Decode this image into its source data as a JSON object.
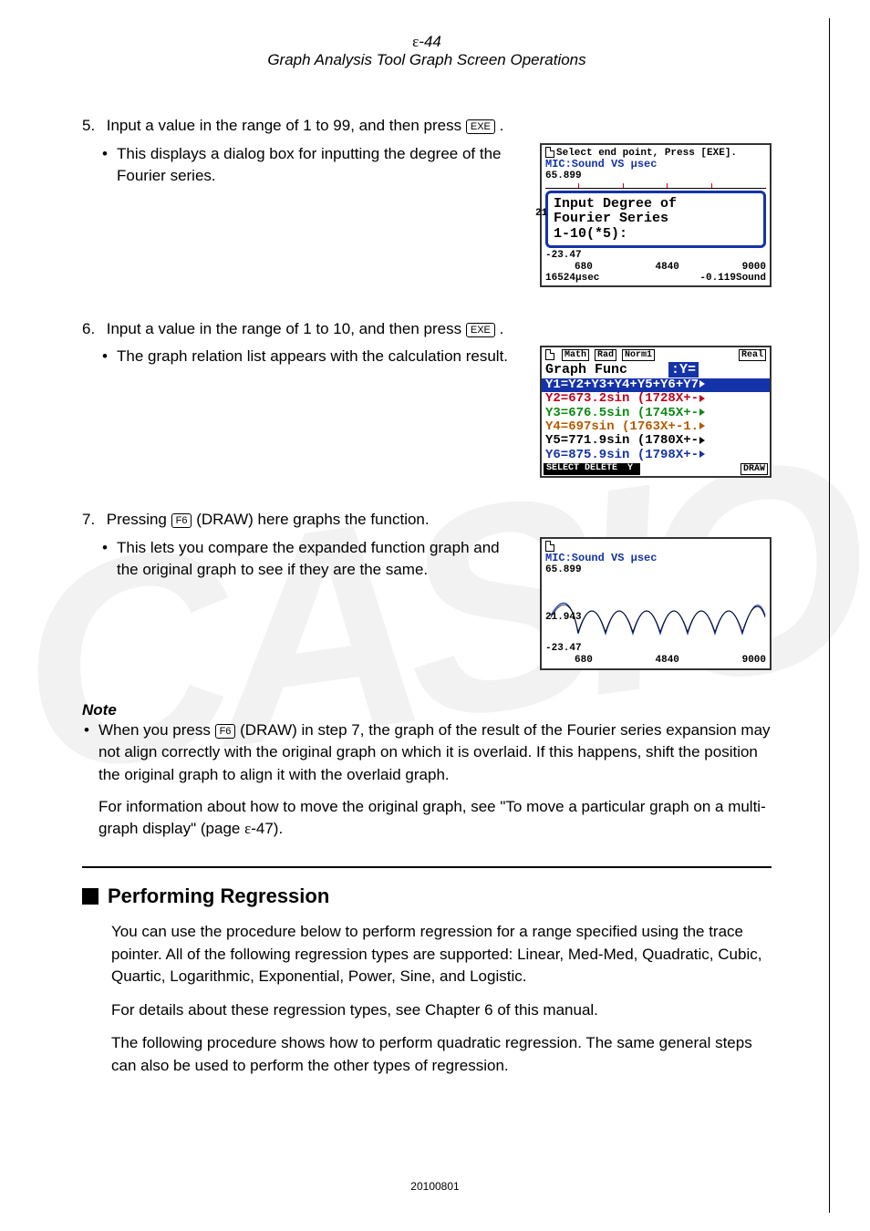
{
  "header": {
    "page_num_prefix": "ε",
    "page_num": "-44",
    "title": "Graph Analysis Tool Graph Screen Operations"
  },
  "watermark": "CASIO",
  "steps": {
    "s5": {
      "num": "5.",
      "text_a": "Input a value in the range of 1 to 99, and then press ",
      "key": "EXE",
      "text_b": ".",
      "bullet": "This displays a dialog box for inputting the degree of the Fourier series."
    },
    "s6": {
      "num": "6.",
      "text_a": "Input a value in the range of 1 to 10, and then press ",
      "key": "EXE",
      "text_b": ".",
      "bullet": "The graph relation list appears with the calculation result."
    },
    "s7": {
      "num": "7.",
      "text_a": "Pressing ",
      "key": "F6",
      "text_mid": "(DRAW) here graphs the function.",
      "bullet": "This lets you compare the expanded function graph and the original graph to see if they are the same."
    }
  },
  "screens": {
    "scr1": {
      "titlebar": "Select end point, Press [EXE].",
      "mic": "MIC:Sound VS μsec",
      "topval": "65.899",
      "dialog_l1": "Input Degree of",
      "dialog_l2": "Fourier Series",
      "dialog_l3": "1-10(*5):",
      "left21": "21",
      "yneg": "-23.47",
      "x0": "680",
      "x1": "4840",
      "x2": "9000",
      "foot_l": "16524μsec",
      "foot_r": "-0.119Sound"
    },
    "scr2": {
      "chips": {
        "math": "Math",
        "rad": "Rad",
        "norm": "Norm1",
        "real": "Real"
      },
      "head_l": "Graph Func",
      "head_r": ":Y=",
      "y1": "Y1=Y2+Y3+Y4+Y5+Y6+Y7",
      "y2": "Y2=673.2sin (1728X+-",
      "y3": "Y3=676.5sin (1745X+-",
      "y4": "Y4=697sin (1763X+-1.",
      "y5": "Y5=771.9sin (1780X+-",
      "y6": "Y6=875.9sin (1798X+-",
      "btns": {
        "select": "SELECT",
        "delete": "DELETE",
        "y": "Y",
        "draw": "DRAW"
      }
    },
    "scr3": {
      "mic": "MIC:Sound VS μsec",
      "topval": "65.899",
      "midval": "21.943",
      "yneg": "-23.47",
      "x0": "680",
      "x1": "4840",
      "x2": "9000"
    }
  },
  "note": {
    "head": "Note",
    "p1_a": "When you press ",
    "p1_key": "F6",
    "p1_b": "(DRAW) in step 7, the graph of the result of the Fourier series expansion may not align correctly with the original graph on which it is overlaid. If this happens, shift the position the original graph to align it with the overlaid graph.",
    "p2_a": "For information about how to move the original graph, see \"To move a particular graph on a multi-graph display\" (page ",
    "p2_eps": "ε",
    "p2_b": "-47)."
  },
  "section": {
    "head": "Performing Regression",
    "p1": "You can use the procedure below to perform regression for a range specified using the trace pointer. All of the following regression types are supported: Linear, Med-Med, Quadratic, Cubic, Quartic, Logarithmic, Exponential, Power, Sine, and Logistic.",
    "p2": "For details about these regression types, see Chapter 6 of this manual.",
    "p3": "The following procedure shows how to perform quadratic regression. The same general steps can also be used to perform the other types of regression."
  },
  "footer": "20100801"
}
